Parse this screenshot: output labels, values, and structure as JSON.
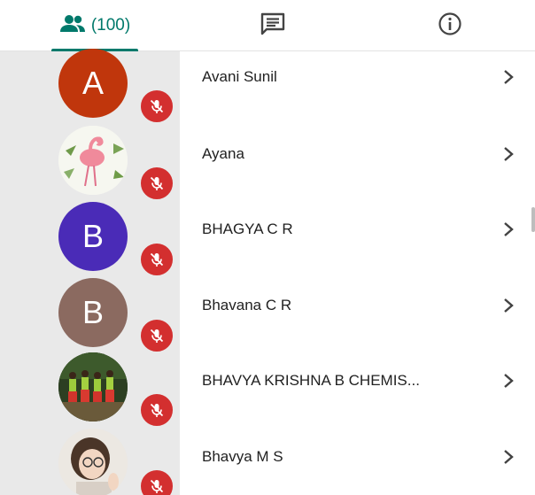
{
  "tabs": {
    "people_count": "(100)",
    "accent_color": "#00796b",
    "icons": [
      "people-icon",
      "chat-icon",
      "info-icon"
    ]
  },
  "participants": [
    {
      "name": "Avani Sunil",
      "avatar_type": "letter",
      "avatar_letter": "A",
      "avatar_color": "#c0360c",
      "muted": true
    },
    {
      "name": "Ayana",
      "avatar_type": "photo",
      "avatar_desc": "flamingo-illustration",
      "muted": true
    },
    {
      "name": "BHAGYA C R",
      "avatar_type": "letter",
      "avatar_letter": "B",
      "avatar_color": "#4a2bb7",
      "muted": true
    },
    {
      "name": "Bhavana C R",
      "avatar_type": "letter",
      "avatar_letter": "B",
      "avatar_color": "#8b6a60",
      "muted": true
    },
    {
      "name": "BHAVYA KRISHNA B CHEMIS...",
      "avatar_type": "photo",
      "avatar_desc": "group-photo",
      "muted": true
    },
    {
      "name": "Bhavya M S",
      "avatar_type": "photo",
      "avatar_desc": "person-photo",
      "muted": true
    }
  ],
  "colors": {
    "mute_badge": "#d32f2f",
    "gutter": "#e9e9e9"
  }
}
